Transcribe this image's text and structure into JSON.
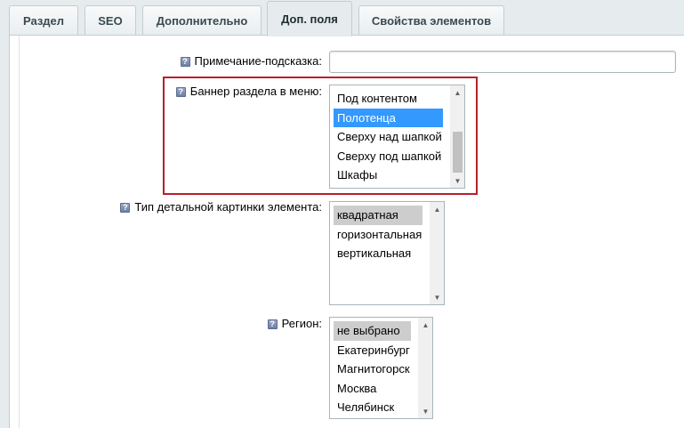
{
  "tabs": [
    {
      "label": "Раздел"
    },
    {
      "label": "SEO"
    },
    {
      "label": "Дополнительно"
    },
    {
      "label": "Доп. поля"
    },
    {
      "label": "Свойства элементов"
    }
  ],
  "active_tab": "Доп. поля",
  "help_icon_glyph": "?",
  "fields": {
    "hint": {
      "label": "Примечание-подсказка:",
      "value": ""
    },
    "banner": {
      "label": "Баннер раздела в меню:",
      "options": [
        "Под контентом",
        "Полотенца",
        "Сверху над шапкой",
        "Сверху под шапкой",
        "Шкафы"
      ],
      "selected": "Полотенца"
    },
    "image_type": {
      "label": "Тип детальной картинки элемента:",
      "options": [
        "квадратная",
        "горизонтальная",
        "вертикальная"
      ],
      "selected": "квадратная"
    },
    "region": {
      "label": "Регион:",
      "options": [
        "не выбрано",
        "Екатеринбург",
        "Магнитогорск",
        "Москва",
        "Челябинск"
      ],
      "selected": "не выбрано"
    }
  },
  "scroll_arrows": {
    "up": "▲",
    "down": "▼"
  },
  "colors": {
    "highlight_border": "#b8202c",
    "selected_active": "#3399ff",
    "selected_inactive": "#cdcdcd",
    "background": "#e6ebed"
  }
}
